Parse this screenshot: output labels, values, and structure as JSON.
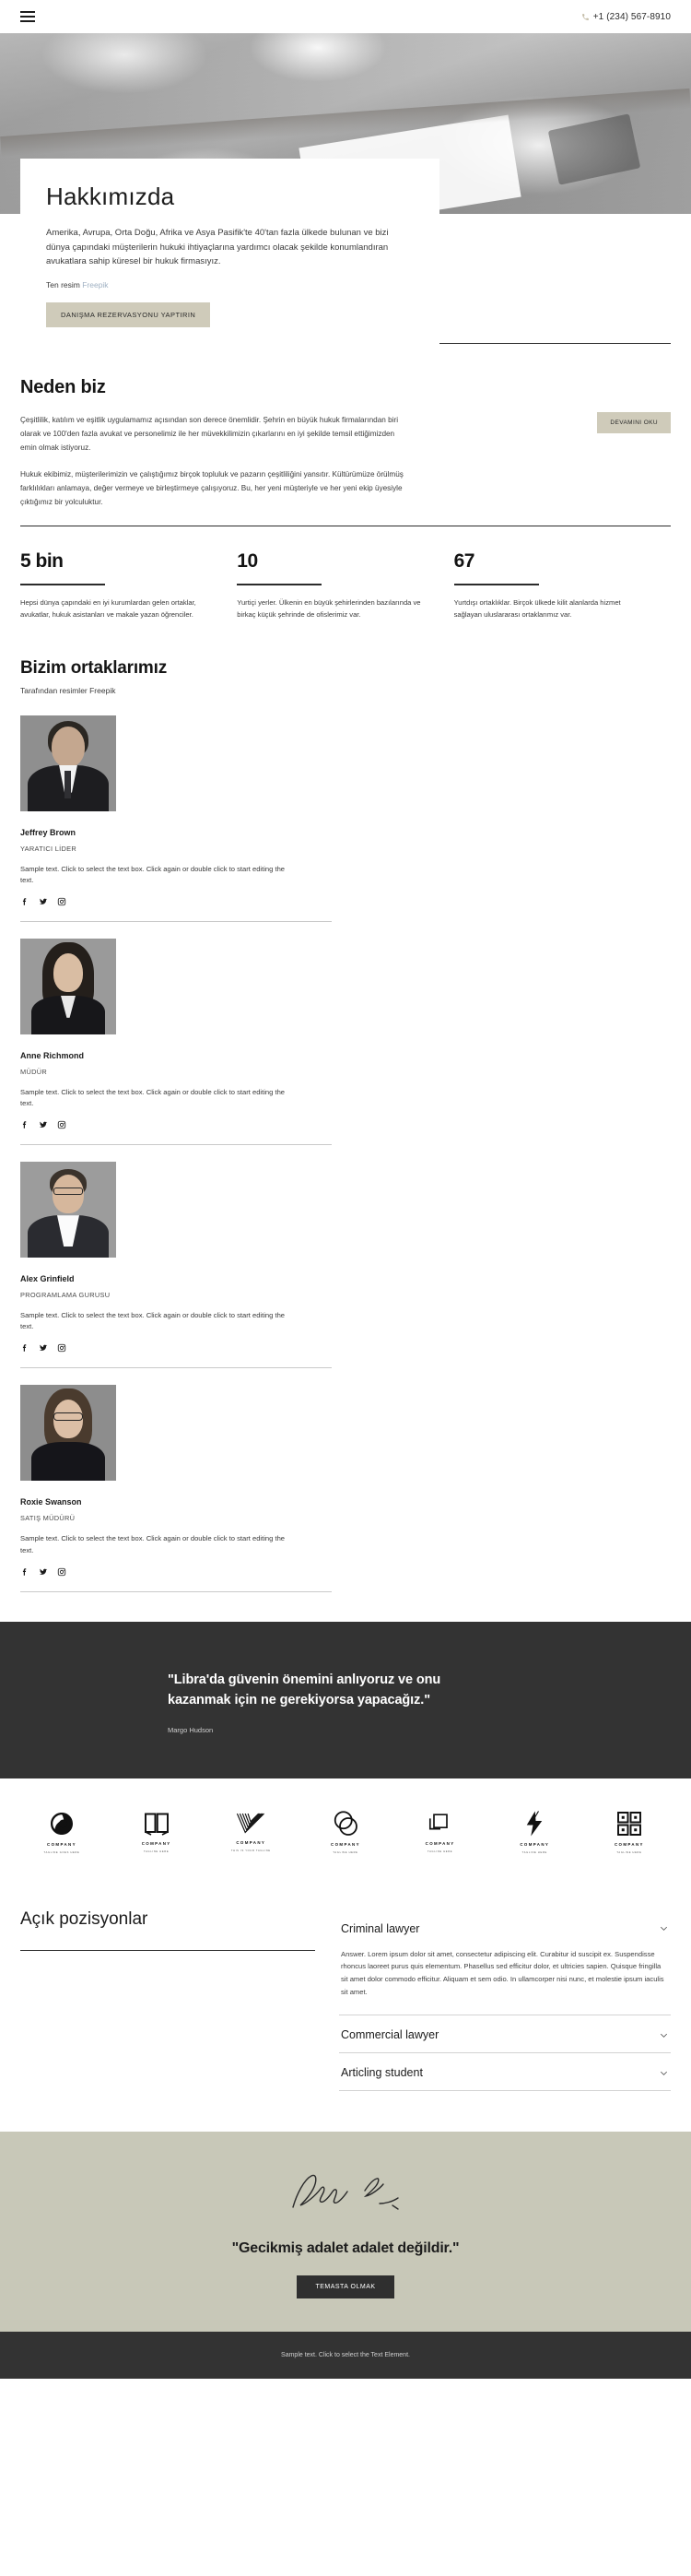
{
  "header": {
    "menu_icon": "hamburger-menu-icon",
    "phone_icon": "phone-icon",
    "phone": "+1 (234) 567-8910"
  },
  "about": {
    "title": "Hakkımızda",
    "paragraph": "Amerika, Avrupa, Orta Doğu, Afrika ve Asya Pasifik'te 40'tan fazla ülkede bulunan ve bizi dünya çapındaki müşterilerin hukuki ihtiyaçlarına yardımcı olacak şekilde konumlandıran avukatlara sahip küresel bir hukuk firmasıyız.",
    "credit_prefix": "Ten resim",
    "credit_link": "Freepik",
    "cta": "DANIŞMA REZERVASYONU YAPTIRIN"
  },
  "why": {
    "title": "Neden biz",
    "paragraph_1": "Çeşitlilik, katılım ve eşitlik uygulamamız açısından son derece önemlidir. Şehrin en büyük hukuk firmalarından biri olarak ve 100'den fazla avukat ve personelimiz ile her müvekkilimizin çıkarlarını en iyi şekilde temsil ettiğimizden emin olmak istiyoruz.",
    "paragraph_2": "Hukuk ekibimiz, müşterilerimizin ve çalıştığımız birçok topluluk ve pazarın çeşitliliğini yansıtır. Kültürümüze örülmüş farklılıkları anlamaya, değer vermeye ve birleştirmeye çalışıyoruz. Bu, her yeni müşteriyle ve her yeni ekip üyesiyle çıktığımız bir yolculuktur.",
    "cta": "DEVAMINI OKU"
  },
  "stats": [
    {
      "value": "5 bin",
      "desc": "Hepsi dünya çapındaki en iyi kurumlardan gelen ortaklar, avukatlar, hukuk asistanları ve makale yazan öğrenciler."
    },
    {
      "value": "10",
      "desc": "Yurtiçi yerler. Ülkenin en büyük şehirlerinden bazılarında ve birkaç küçük şehrinde de ofislerimiz var."
    },
    {
      "value": "67",
      "desc": "Yurtdışı ortaklıklar. Birçok ülkede kilit alanlarda hizmet sağlayan uluslararası ortaklarımız var."
    }
  ],
  "partners": {
    "title": "Bizim ortaklarımız",
    "subtitle": "Tarafından resimler Freepik",
    "members": [
      {
        "name": "Jeffrey Brown",
        "role": "YARATICI LİDER",
        "blurb": "Sample text. Click to select the text box. Click again or double click to start editing the text."
      },
      {
        "name": "Anne Richmond",
        "role": "MÜDÜR",
        "blurb": "Sample text. Click to select the text box. Click again or double click to start editing the text."
      },
      {
        "name": "Alex Grinfield",
        "role": "PROGRAMLAMA GURUSU",
        "blurb": "Sample text. Click to select the text box. Click again or double click to start editing the text."
      },
      {
        "name": "Roxie Swanson",
        "role": "SATIŞ MÜDÜRÜ",
        "blurb": "Sample text. Click to select the text box. Click again or double click to start editing the text."
      }
    ],
    "social_icons": [
      "facebook-icon",
      "twitter-icon",
      "instagram-icon"
    ]
  },
  "quote": {
    "text": "\"Libra'da güvenin önemini anlıyoruz ve onu kazanmak için ne gerekiyorsa yapacağız.\"",
    "author": "Margo Hudson"
  },
  "logos": [
    {
      "name": "COMPANY",
      "tagline": "TAGLINE GOES HERE",
      "icon": "ring-swirl-logo-icon"
    },
    {
      "name": "COMPANY",
      "tagline": "TAGLINE HERE",
      "icon": "open-book-logo-icon"
    },
    {
      "name": "COMPANY",
      "tagline": "THIS IS YOUR TAGLINE",
      "icon": "checkmark-stripes-logo-icon"
    },
    {
      "name": "COMPANY",
      "tagline": "TAGLINE HERE",
      "icon": "overlapping-circles-logo-icon"
    },
    {
      "name": "COMPANY",
      "tagline": "TAGLINE HERE",
      "icon": "bracket-square-logo-icon"
    },
    {
      "name": "COMPANY",
      "tagline": "TAGLINE HERE",
      "icon": "lightning-bolt-logo-icon"
    },
    {
      "name": "COMPANY",
      "tagline": "TAGLINE HERE",
      "icon": "grid-blocks-logo-icon"
    }
  ],
  "vacancies": {
    "title": "Açık pozisyonlar",
    "items": [
      {
        "label": "Criminal lawyer",
        "expanded": true,
        "body": "Answer. Lorem ipsum dolor sit amet, consectetur adipiscing elit. Curabitur id suscipit ex. Suspendisse rhoncus laoreet purus quis elementum. Phasellus sed efficitur dolor, et ultricies sapien. Quisque fringilla sit amet dolor commodo efficitur. Aliquam et sem odio. In ullamcorper nisi nunc, et molestie ipsum iaculis sit amet."
      },
      {
        "label": "Commercial lawyer",
        "expanded": false,
        "body": ""
      },
      {
        "label": "Articling student",
        "expanded": false,
        "body": ""
      }
    ],
    "chevron_icon": "chevron-down-icon"
  },
  "signature": {
    "signature_icon": "handwritten-signature-icon",
    "headline": "\"Gecikmiş adalet adalet değildir.\"",
    "cta": "TEMASTA OLMAK"
  },
  "footer": {
    "text": "Sample text. Click to select the Text Element."
  },
  "colors": {
    "tan_button": "#cfcbba",
    "dark_band": "#333333",
    "sign_band": "#c8c8b8",
    "link_blue": "#9fb0c2"
  }
}
